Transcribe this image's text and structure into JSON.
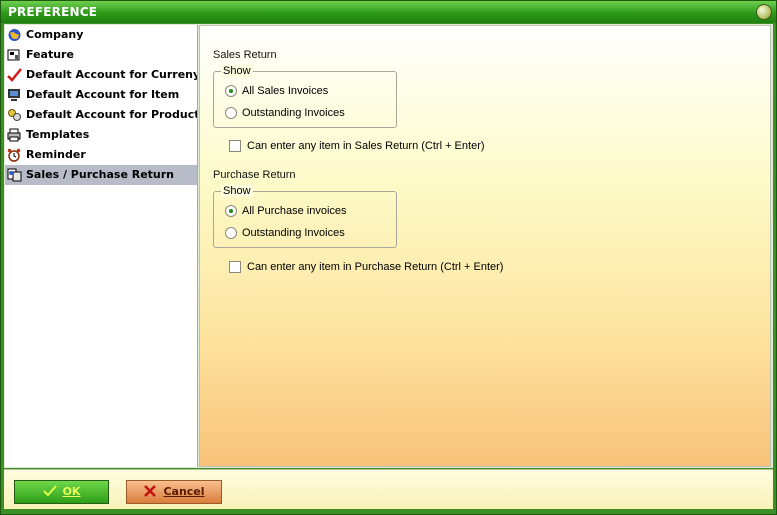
{
  "window": {
    "title": "PREFERENCE"
  },
  "sidebar": {
    "items": [
      {
        "label": "Company",
        "icon": "globe-icon"
      },
      {
        "label": "Feature",
        "icon": "feature-icon"
      },
      {
        "label": "Default Account for Curreny",
        "icon": "checkmark-icon"
      },
      {
        "label": "Default Account for Item",
        "icon": "computer-icon"
      },
      {
        "label": "Default Account for Production",
        "icon": "production-icon"
      },
      {
        "label": "Templates",
        "icon": "printer-icon"
      },
      {
        "label": "Reminder",
        "icon": "alarm-clock-icon"
      },
      {
        "label": "Sales / Purchase Return",
        "icon": "return-icon",
        "selected": true
      }
    ]
  },
  "sales_return": {
    "title": "Sales Return",
    "show_label": "Show",
    "options": [
      {
        "label": "All Sales Invoices",
        "selected": true
      },
      {
        "label": "Outstanding Invoices",
        "selected": false
      }
    ],
    "checkbox_label": "Can enter any item in Sales Return (Ctrl + Enter)",
    "checkbox_checked": false
  },
  "purchase_return": {
    "title": "Purchase Return",
    "show_label": "Show",
    "options": [
      {
        "label": "All Purchase invoices",
        "selected": true
      },
      {
        "label": "Outstanding Invoices",
        "selected": false
      }
    ],
    "checkbox_label": "Can enter any item in Purchase Return (Ctrl + Enter)",
    "checkbox_checked": false
  },
  "footer": {
    "ok_label": "OK",
    "cancel_label": "Cancel"
  },
  "colors": {
    "title_bar": "#2e9a1a",
    "selected_item": "#b8bcc8",
    "radio_dot": "#1f8a14",
    "ok_button": "#2d9d18",
    "cancel_button": "#d97d3b"
  }
}
